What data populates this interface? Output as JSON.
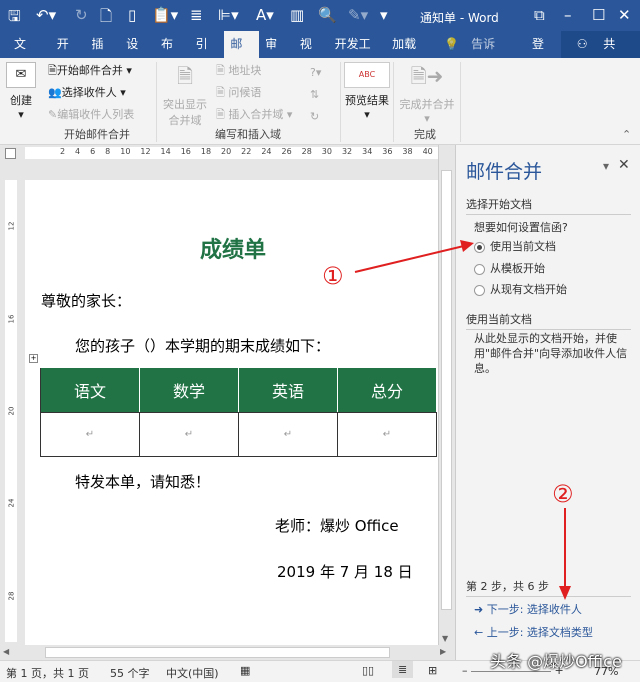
{
  "window": {
    "title": "通知单 - Word"
  },
  "tabs": [
    "文件",
    "开始",
    "插入",
    "设计",
    "布局",
    "引用",
    "邮件",
    "审阅",
    "视图",
    "开发工具",
    "加载项"
  ],
  "tell_me": "告诉我...",
  "sign_in": "登录",
  "share": "共享",
  "ribbon": {
    "create": "创建",
    "start_merge": "开始邮件合并",
    "select_recipients": "选择收件人",
    "edit_recipients": "编辑收件人列表",
    "group1": "开始邮件合并",
    "highlight": "突出显示",
    "highlight2": "合并域",
    "address_block": "地址块",
    "greeting": "问候语",
    "insert_field": "插入合并域",
    "group2": "编写和插入域",
    "preview": "预览结果",
    "finish": "完成并合并",
    "group3": "完成"
  },
  "ruler": [
    "2",
    "4",
    "6",
    "8",
    "10",
    "12",
    "14",
    "16",
    "18",
    "20",
    "22",
    "24",
    "26",
    "28",
    "30",
    "32",
    "34",
    "36",
    "38",
    "40"
  ],
  "vruler": [
    "12",
    "16",
    "20",
    "24",
    "28"
  ],
  "doc": {
    "title": "成绩单",
    "greeting": "尊敬的家长：",
    "intro": "您的孩子（）本学期的期末成绩如下：",
    "headers": [
      "语文",
      "数学",
      "英语",
      "总分"
    ],
    "closing": "特发本单，请知悉！",
    "signature": "老师：爆炒 Office",
    "date": "2019 年 7 月 18 日"
  },
  "pane": {
    "title": "邮件合并",
    "section1": "选择开始文档",
    "question": "想要如何设置信函?",
    "options": [
      "使用当前文档",
      "从模板开始",
      "从现有文档开始"
    ],
    "section2": "使用当前文档",
    "desc": "从此处显示的文档开始，并使用\"邮件合并\"向导添加收件人信息。",
    "step": "第 2 步，共 6 步",
    "next": "下一步: 选择收件人",
    "prev": "上一步: 选择文档类型"
  },
  "annotations": [
    "①",
    "②"
  ],
  "status": {
    "page": "第 1 页，共 1 页",
    "words": "55 个字",
    "lang": "中文(中国)",
    "zoom": "77%"
  },
  "watermark": "头条 @爆炒Office"
}
